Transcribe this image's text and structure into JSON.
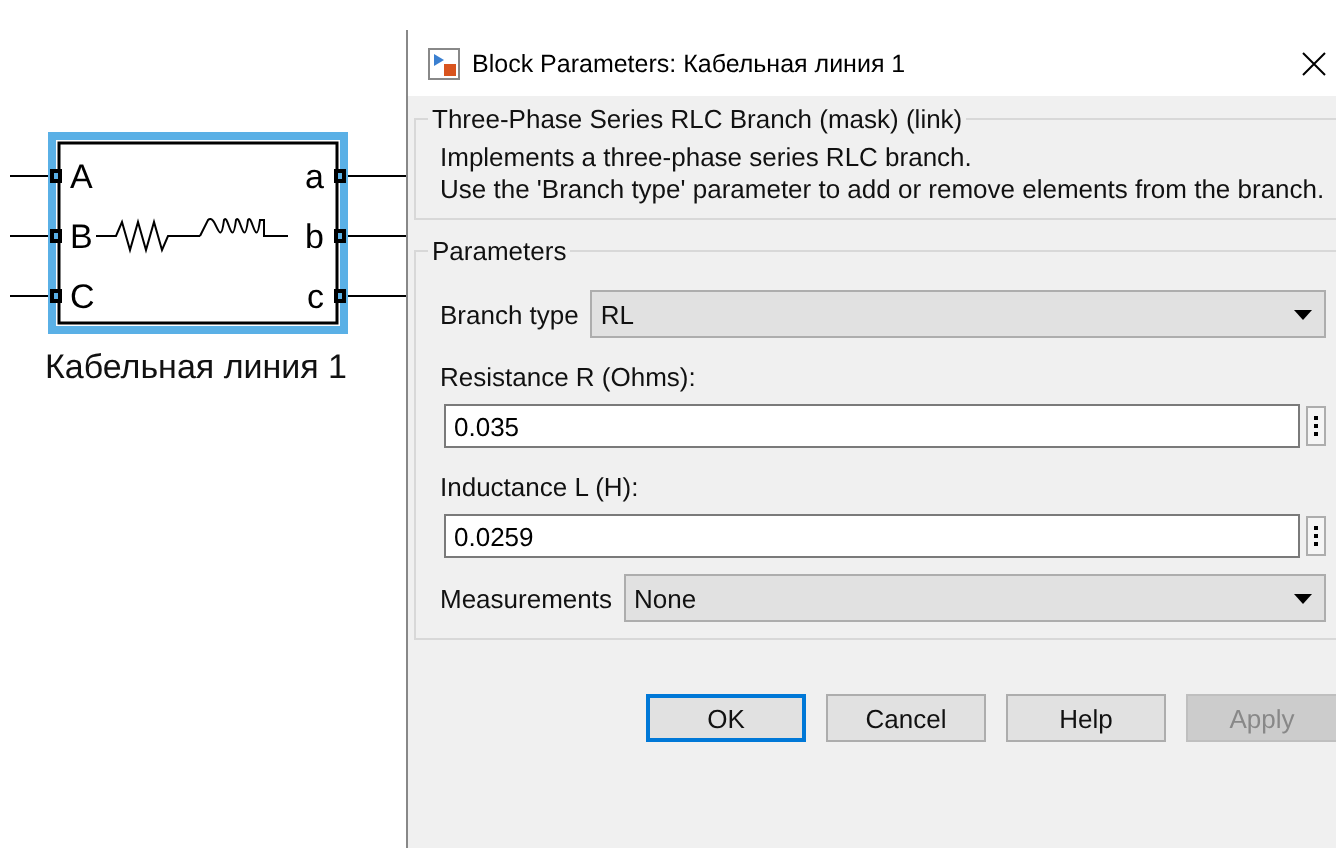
{
  "block": {
    "label": "Кабельная линия 1",
    "selected": true,
    "inputs": [
      "A",
      "B",
      "C"
    ],
    "outputs": [
      "a",
      "b",
      "c"
    ]
  },
  "dialog": {
    "title": "Block Parameters: Кабельная линия 1",
    "mask": {
      "title": "Three-Phase Series RLC Branch (mask) (link)",
      "description": [
        "Implements a three-phase series RLC branch.",
        "Use the 'Branch type' parameter to add or remove elements from the branch."
      ]
    },
    "parameters": {
      "title": "Parameters",
      "fields": [
        {
          "kind": "dropdown",
          "label": "Branch type",
          "value": "RL"
        },
        {
          "kind": "text",
          "label": "Resistance R (Ohms):",
          "value": "0.035"
        },
        {
          "kind": "text",
          "label": "Inductance L (H):",
          "value": "0.0259"
        },
        {
          "kind": "dropdown",
          "label": "Measurements",
          "value": "None"
        }
      ]
    },
    "buttons": [
      {
        "label": "OK",
        "default": true,
        "disabled": false
      },
      {
        "label": "Cancel",
        "default": false,
        "disabled": false
      },
      {
        "label": "Help",
        "default": false,
        "disabled": false
      },
      {
        "label": "Apply",
        "default": false,
        "disabled": true
      }
    ]
  }
}
